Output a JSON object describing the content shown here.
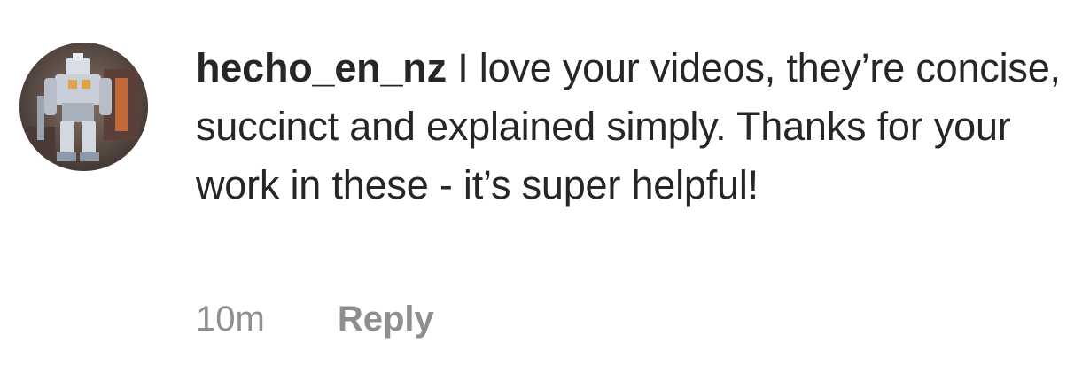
{
  "comment": {
    "username": "hecho_en_nz",
    "text": "I love your videos, they’re concise, succinct and explained simply. Thanks for your work in these - it’s super helpful!",
    "timestamp": "10m",
    "reply_label": "Reply"
  }
}
